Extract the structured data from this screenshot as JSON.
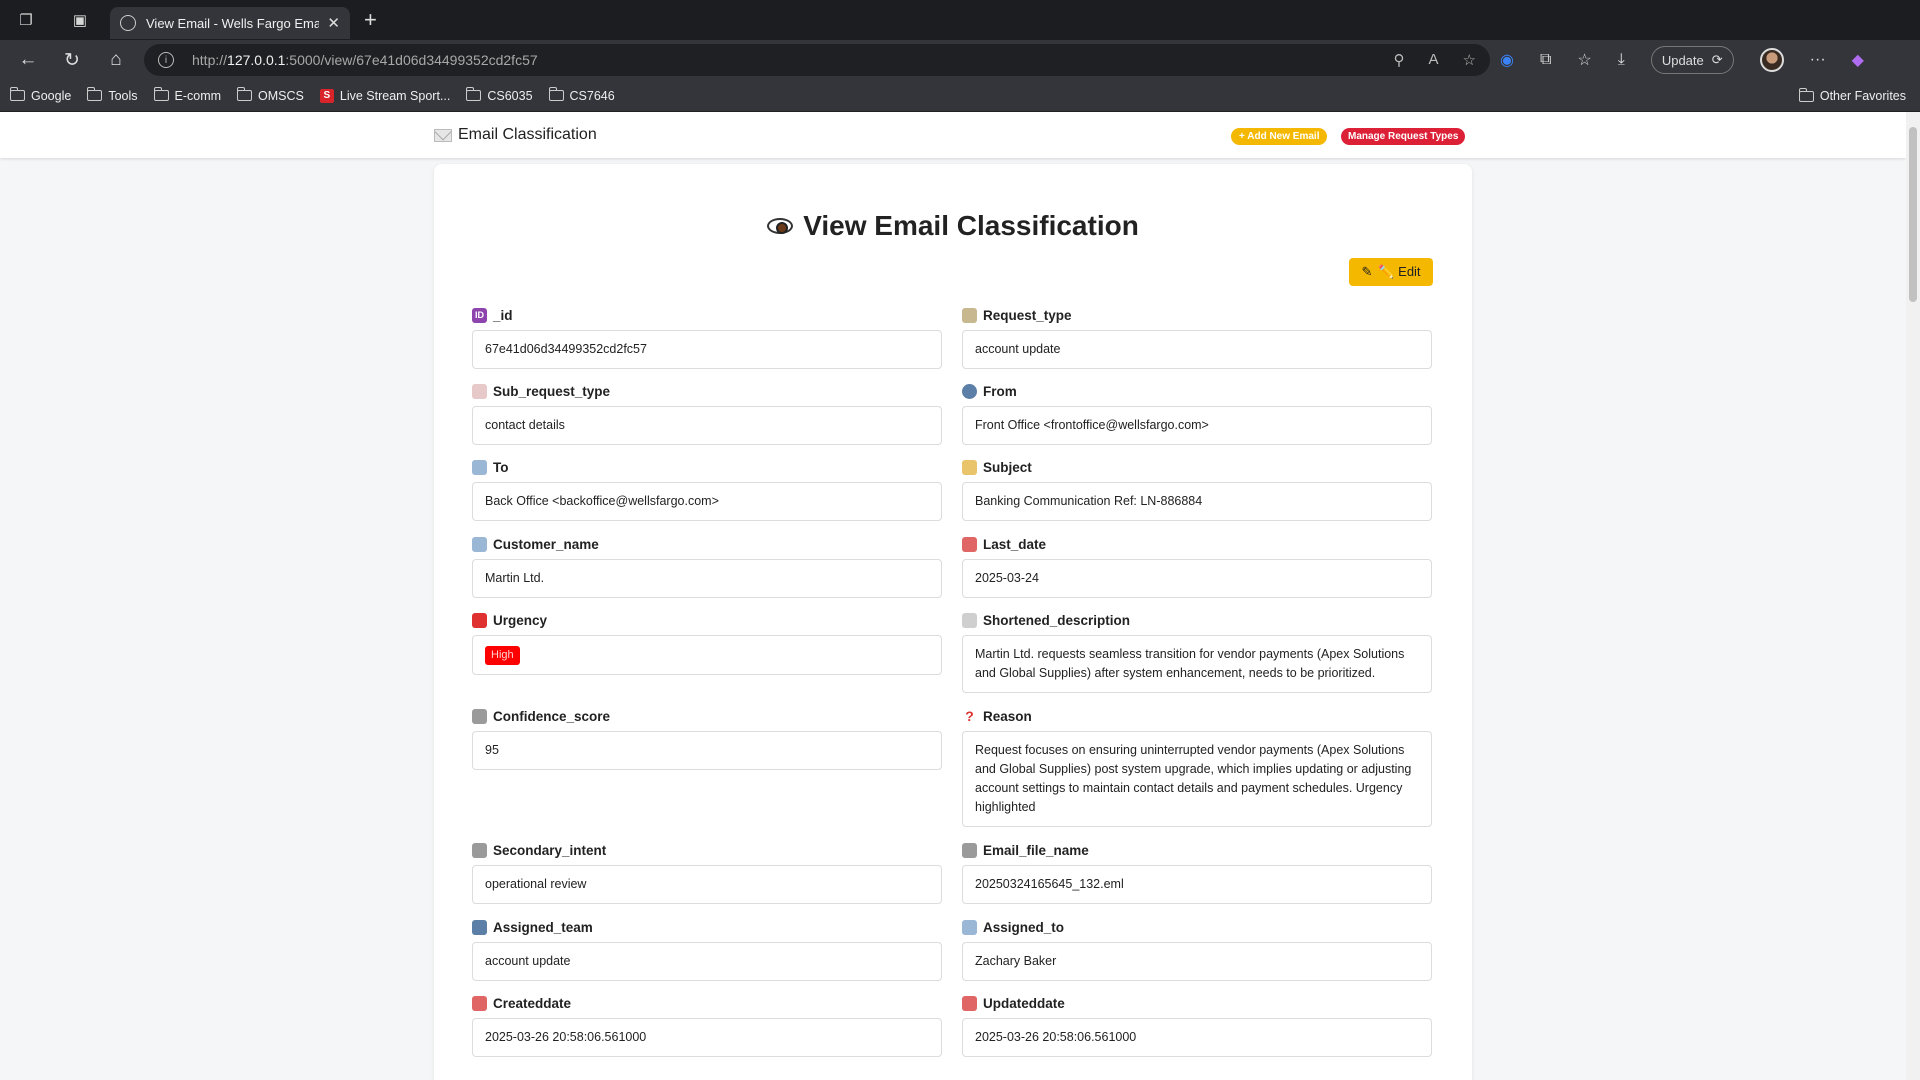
{
  "browser": {
    "tab_title": "View Email - Wells Fargo Email",
    "url_prefix": "http://",
    "url_host": "127.0.0.1",
    "url_rest": ":5000/view/67e41d06d34499352cd2fc57",
    "update_label": "Update",
    "bookmarks": [
      "Google",
      "Tools",
      "E-comm",
      "OMSCS",
      "Live Stream Sport...",
      "CS6035",
      "CS7646"
    ],
    "other_favorites": "Other Favorites"
  },
  "nav": {
    "brand": "Email Classification",
    "add_label": "+ Add New Email",
    "manage_label": "Manage Request Types"
  },
  "main": {
    "title": "View Email Classification",
    "edit_label": "✏️ Edit"
  },
  "fields": {
    "id": {
      "label": "_id",
      "value": "67e41d06d34499352cd2fc57"
    },
    "request_type": {
      "label": "Request_type",
      "value": "account update"
    },
    "sub_request_type": {
      "label": "Sub_request_type",
      "value": "contact details"
    },
    "from": {
      "label": "From",
      "value": "Front Office <frontoffice@wellsfargo.com>"
    },
    "to": {
      "label": "To",
      "value": "Back Office <backoffice@wellsfargo.com>"
    },
    "subject": {
      "label": "Subject",
      "value": "Banking Communication Ref: LN-886884"
    },
    "customer_name": {
      "label": "Customer_name",
      "value": "Martin Ltd."
    },
    "last_date": {
      "label": "Last_date",
      "value": "2025-03-24"
    },
    "urgency": {
      "label": "Urgency",
      "value": "High"
    },
    "shortened_description": {
      "label": "Shortened_description",
      "value": "Martin Ltd. requests seamless transition for vendor payments (Apex Solutions and Global Supplies) after system enhancement, needs to be prioritized."
    },
    "confidence_score": {
      "label": "Confidence_score",
      "value": "95"
    },
    "reason": {
      "label": "Reason",
      "value": "Request focuses on ensuring uninterrupted vendor payments (Apex Solutions and Global Supplies) post system upgrade, which implies updating or adjusting account settings to maintain contact details and payment schedules. Urgency highlighted"
    },
    "secondary_intent": {
      "label": "Secondary_intent",
      "value": "operational review"
    },
    "email_file_name": {
      "label": "Email_file_name",
      "value": "20250324165645_132.eml"
    },
    "assigned_team": {
      "label": "Assigned_team",
      "value": "account update"
    },
    "assigned_to": {
      "label": "Assigned_to",
      "value": "Zachary Baker"
    },
    "createddate": {
      "label": "Createddate",
      "value": "2025-03-26 20:58:06.561000"
    },
    "updateddate": {
      "label": "Updateddate",
      "value": "2025-03-26 20:58:06.561000"
    }
  },
  "colors": {
    "add_button": "#f5b800",
    "manage_button": "#dc2137",
    "edit_button": "#f5b800",
    "urgency_high": "#ff0000"
  }
}
